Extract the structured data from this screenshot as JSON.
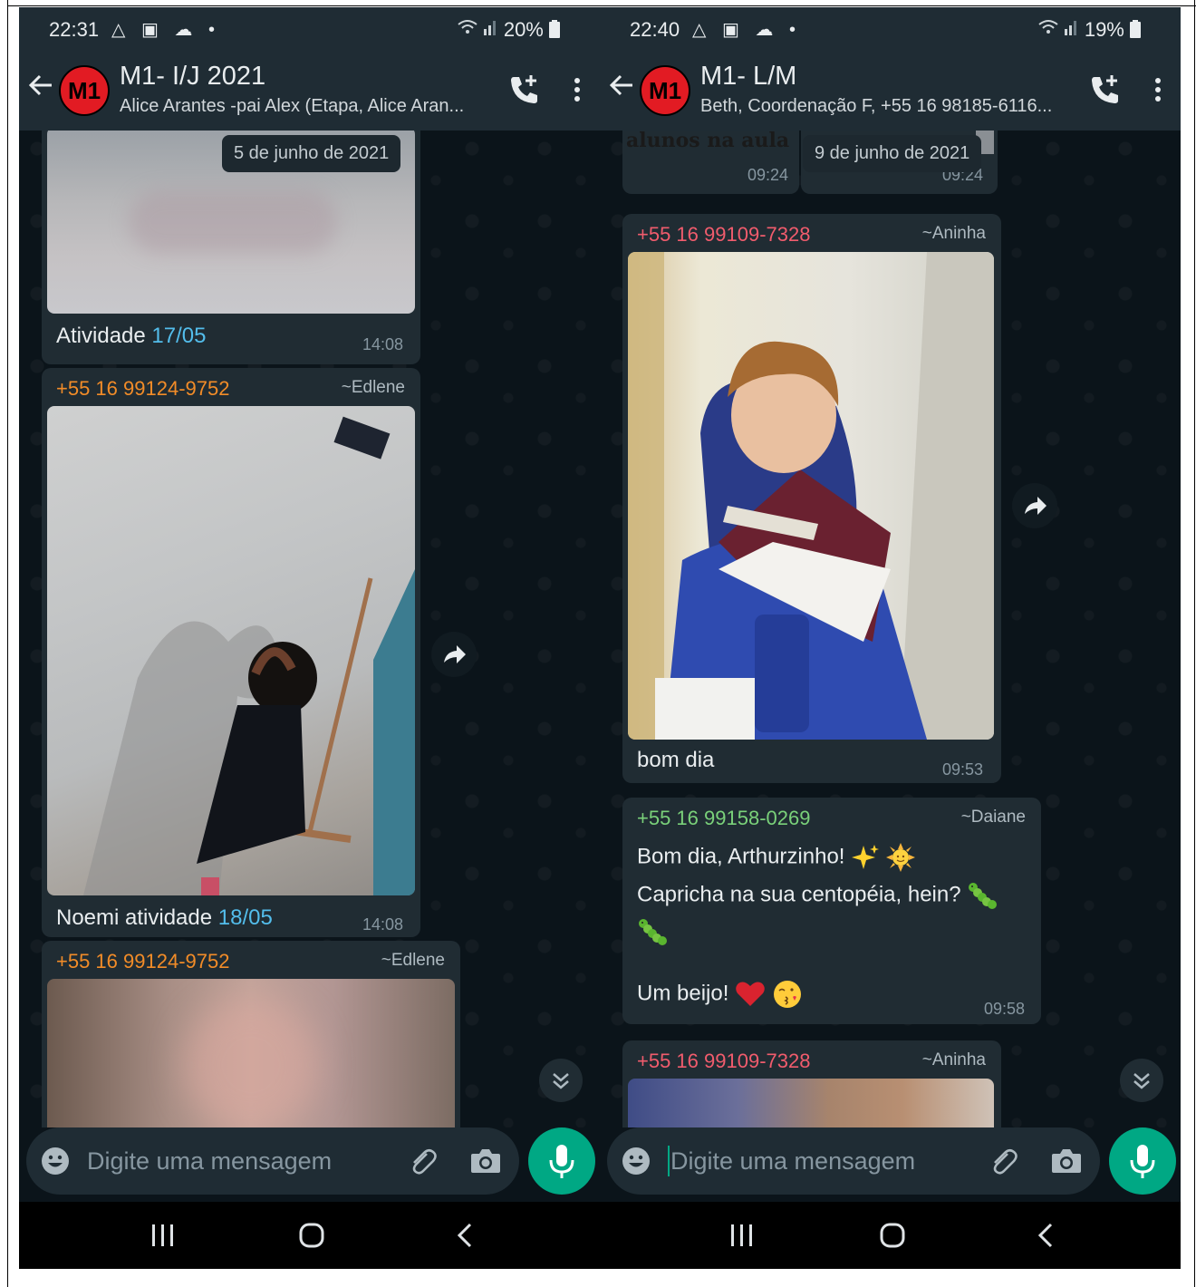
{
  "left": {
    "status": {
      "time": "22:31",
      "battery": "20%"
    },
    "header": {
      "avatar_text": "M1",
      "title": "M1- I/J 2021",
      "subtitle": "Alice Arantes -pai Alex (Etapa, Alice Aran..."
    },
    "date_chip": "5 de junho de 2021",
    "msg1": {
      "caption_prefix": "Atividade ",
      "caption_link": "17/05",
      "time": "14:08"
    },
    "msg2": {
      "sender": "+55 16 99124-9752",
      "alias": "~Edlene",
      "caption_prefix": "Noemi atividade ",
      "caption_link": "18/05",
      "time": "14:08"
    },
    "msg3": {
      "sender": "+55 16 99124-9752",
      "alias": "~Edlene"
    },
    "input_placeholder": "Digite uma mensagem"
  },
  "right": {
    "status": {
      "time": "22:40",
      "battery": "19%"
    },
    "header": {
      "avatar_text": "M1",
      "title": "M1- L/M",
      "subtitle": "Beth, Coordenação F, +55 16 98185-6116..."
    },
    "top_fragment": {
      "text": "alunos na aula",
      "time_a": "09:24",
      "time_b": "09:24"
    },
    "date_chip": "9 de junho de 2021",
    "msg1": {
      "sender": "+55 16 99109-7328",
      "alias": "~Aninha",
      "caption": "bom dia",
      "time": "09:53"
    },
    "msg2": {
      "sender": "+55 16 99158-0269",
      "alias": "~Daiane",
      "line1": "Bom dia, Arthurzinho!",
      "line2": "Capricha na sua centopéia, hein?",
      "line3": "Um beijo!",
      "time": "09:58"
    },
    "msg3": {
      "sender": "+55 16 99109-7328",
      "alias": "~Aninha"
    },
    "input_placeholder": "Digite uma mensagem"
  },
  "icons": [
    "back-arrow-icon",
    "add-call-icon",
    "more-vert-icon",
    "forward-icon",
    "scroll-down-icon",
    "emoji-icon",
    "attach-icon",
    "camera-icon",
    "mic-icon",
    "recents-icon",
    "home-icon",
    "nav-back-icon",
    "wifi-icon",
    "signal-icon",
    "battery-icon"
  ],
  "colors": {
    "app_bg": "#0b141a",
    "bar_bg": "#1f2c34",
    "bubble_bg": "#202c33",
    "accent": "#00a884",
    "link": "#53bdeb"
  }
}
